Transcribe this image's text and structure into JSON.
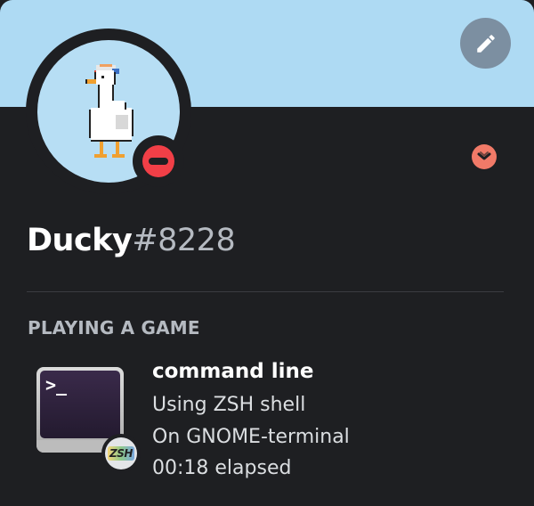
{
  "colors": {
    "banner": "#aedaf3",
    "background": "#1e1f22",
    "status_dnd": "#f13f47",
    "badge": "#f17a68",
    "edit_button": "#7c8fa1"
  },
  "header": {
    "edit_icon": "pencil-icon",
    "badge_icon": "chevron-down-icon"
  },
  "user": {
    "avatar": "pixel-goose-with-cap",
    "status": "do-not-disturb",
    "name": "Ducky",
    "discriminator": "#8228"
  },
  "activity": {
    "section_title": "PLAYING A GAME",
    "game_icon": "terminal-icon",
    "small_icon_text": "ZSH",
    "name": "command line",
    "details": "Using ZSH shell",
    "state": "On GNOME-terminal",
    "elapsed": "00:18 elapsed"
  }
}
